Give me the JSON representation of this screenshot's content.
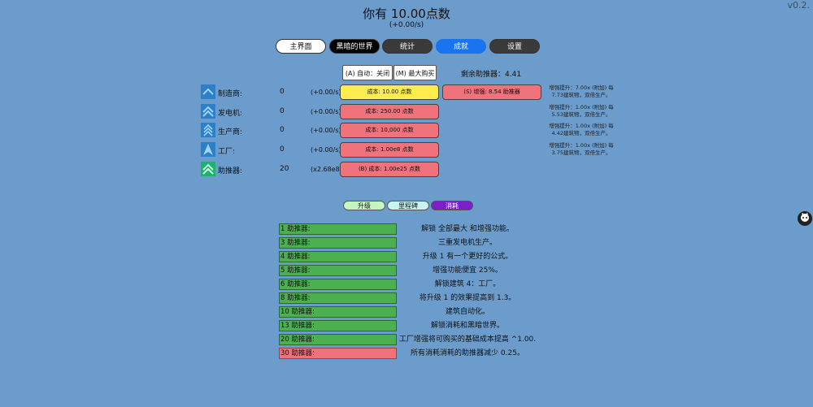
{
  "version": "v0.2.",
  "header": {
    "points": "你有 10.00点数",
    "rate": "(+0.00/s)"
  },
  "tabs": [
    "主界面",
    "黑暗的世界",
    "统计",
    "成就",
    "设置"
  ],
  "controls": {
    "auto": "(A) 自动：关闭",
    "max": "(M) 最大购买"
  },
  "boosters_left": "剩余助推器：4.41",
  "buildings": [
    {
      "name": "制造商:",
      "count": "0",
      "rate": "(+0.00/s)",
      "cost": "成本: 10.00 点数",
      "info": "增强提升：7.00x (附加) 每 7.73建筑物，双倍生产。"
    },
    {
      "name": "发电机:",
      "count": "0",
      "rate": "(+0.00/s)",
      "cost": "成本: 250.00 点数",
      "info": "增强提升：1.00x (附加) 每 5.53建筑物，双倍生产。"
    },
    {
      "name": "生产商:",
      "count": "0",
      "rate": "(+0.00/s)",
      "cost": "成本: 10,000 点数",
      "info": "增强提升：1.00x (附加) 每 4.42建筑物，双倍生产。"
    },
    {
      "name": "工厂:",
      "count": "0",
      "rate": "(+0.00/s)",
      "cost": "成本: 1.00e8 点数",
      "info": "增强提升：1.00x (附加) 每 3.75建筑物，双倍生产。"
    },
    {
      "name": "助推器:",
      "count": "20",
      "rate": "(x2.68e8)",
      "cost": "(B) 成本:  1.00e25 点数",
      "info": ""
    }
  ],
  "boost_button": "(S) 增强: 8.54 助推器",
  "subtabs": [
    "升级",
    "里程碑",
    "消耗"
  ],
  "milestones": [
    {
      "label": "1 助推器:",
      "desc": "解锁 全部最大 和增强功能。",
      "done": true
    },
    {
      "label": "3 助推器:",
      "desc": "三重发电机生产。",
      "done": true
    },
    {
      "label": "4 助推器:",
      "desc": "升级 1 有一个更好的公式。",
      "done": true
    },
    {
      "label": "5 助推器:",
      "desc": "增强功能便宜 25%。",
      "done": true
    },
    {
      "label": "6 助推器:",
      "desc": "解锁建筑 4：工厂。",
      "done": true
    },
    {
      "label": "8 助推器:",
      "desc": "将升级 1 的效果提高到 1.3。",
      "done": true
    },
    {
      "label": "10 助推器:",
      "desc": "建筑自动化。",
      "done": true
    },
    {
      "label": "13 助推器:",
      "desc": "解锁消耗和黑暗世界。",
      "done": true
    },
    {
      "label": "20 助推器:",
      "desc": "工厂增强将可购买的基础成本提高 ^1.00.",
      "done": true
    },
    {
      "label": "30 助推器:",
      "desc": "所有消耗消耗的助推器减少 0.25。",
      "done": false
    }
  ],
  "colors": {
    "background": "#6b9ccc",
    "done": "#4caf50",
    "locked": "#f0727b",
    "cost_affordable": "#ffec4f"
  },
  "icons": [
    "chevron-up-icon",
    "github-icon"
  ]
}
